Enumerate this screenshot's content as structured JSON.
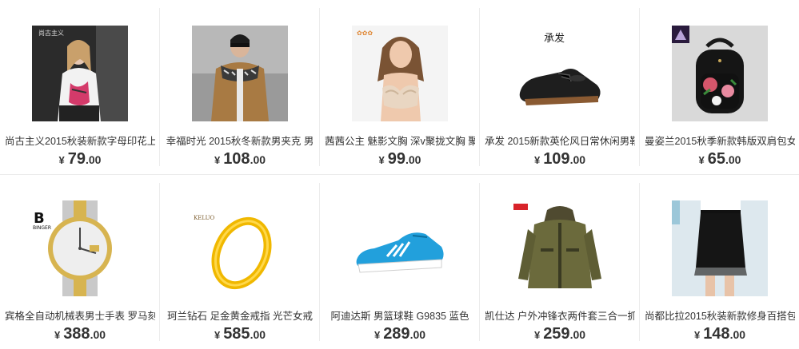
{
  "currency_symbol": "¥",
  "products": [
    {
      "title": "尚古主义2015秋装新款字母印花上",
      "price_int": "79",
      "price_dec": ".00",
      "brand_text": "尚古主义",
      "image_icon": "woman-blouse-photo"
    },
    {
      "title": "幸福时光 2015秋冬新款男夹克 男",
      "price_int": "108",
      "price_dec": ".00",
      "brand_text": "",
      "image_icon": "man-jacket-photo"
    },
    {
      "title": "茜茜公主 魅影文胸 深v聚拢文胸 聚",
      "price_int": "99",
      "price_dec": ".00",
      "brand_text": "",
      "image_icon": "bra-model-photo"
    },
    {
      "title": "承发 2015新款英伦风日常休闲男鞋",
      "price_int": "109",
      "price_dec": ".00",
      "brand_text": "承发",
      "image_icon": "leather-shoe-photo"
    },
    {
      "title": "曼姿兰2015秋季新款韩版双肩包女",
      "price_int": "65",
      "price_dec": ".00",
      "brand_text": "",
      "image_icon": "floral-backpack-photo"
    },
    {
      "title": "宾格全自动机械表男士手表 罗马刻",
      "price_int": "388",
      "price_dec": ".00",
      "brand_text": "BINGER",
      "image_icon": "wristwatch-photo"
    },
    {
      "title": "珂兰钻石 足金黄金戒指 光芒女戒",
      "price_int": "585",
      "price_dec": ".00",
      "brand_text": "KELUO",
      "image_icon": "gold-ring-photo"
    },
    {
      "title": "阿迪达斯 男篮球鞋 G9835 蓝色",
      "price_int": "289",
      "price_dec": ".00",
      "brand_text": "",
      "image_icon": "blue-sneaker-photo"
    },
    {
      "title": "凯仕达 户外冲锋衣两件套三合一抓",
      "price_int": "259",
      "price_dec": ".00",
      "brand_text": "",
      "image_icon": "outdoor-jacket-photo"
    },
    {
      "title": "尚都比拉2015秋装新款修身百搭包",
      "price_int": "148",
      "price_dec": ".00",
      "brand_text": "",
      "image_icon": "black-skirt-photo"
    }
  ]
}
